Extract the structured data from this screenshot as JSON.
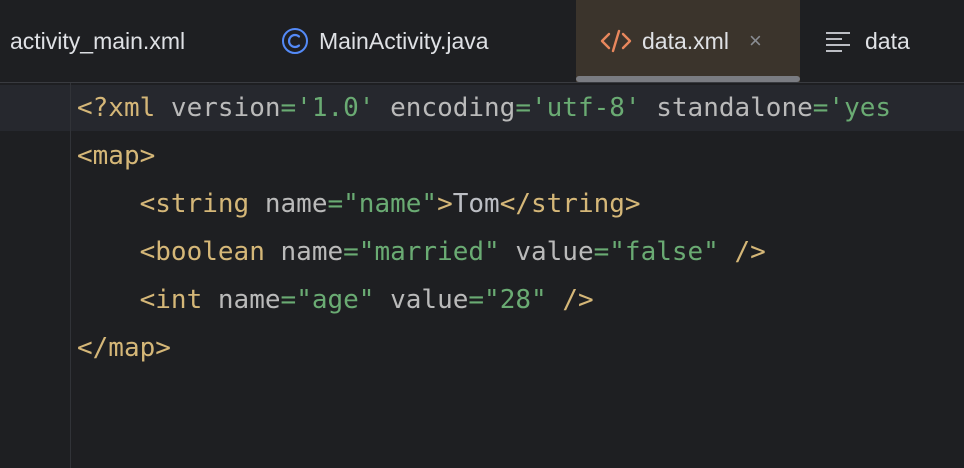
{
  "tabs": [
    {
      "label": "activity_main.xml",
      "active": false
    },
    {
      "label": "MainActivity.java",
      "icon": "java-class-icon",
      "active": false
    },
    {
      "label": "data.xml",
      "icon": "xml-code-icon",
      "active": true,
      "close": "×"
    },
    {
      "label": "data",
      "icon": "text-lines-icon",
      "active": false
    }
  ],
  "colors": {
    "background": "#1e1f22",
    "active_tab": "#3b342c",
    "tag": "#d5b778",
    "attribute": "#bababa",
    "string_value": "#6aab73",
    "text": "#bcbec4",
    "java_icon": "#548af7",
    "xml_icon": "#e8875d"
  },
  "code": {
    "line1": {
      "open": "<?xml",
      "a1": " version",
      "eq1": "=",
      "v1": "'1.0'",
      "a2": " encoding",
      "eq2": "=",
      "v2": "'utf-8'",
      "a3": " standalone",
      "eq3": "=",
      "v3": "'yes"
    },
    "line2": {
      "tag": "<map>"
    },
    "line3": {
      "indent": "    ",
      "open": "<string",
      "a1": " name",
      "eq1": "=",
      "v1": "\"name\"",
      "close": ">",
      "text": "Tom",
      "end": "</string>"
    },
    "line4": {
      "indent": "    ",
      "open": "<boolean",
      "a1": " name",
      "eq1": "=",
      "v1": "\"married\"",
      "a2": " value",
      "eq2": "=",
      "v2": "\"false\"",
      "end": " />"
    },
    "line5": {
      "indent": "    ",
      "open": "<int",
      "a1": " name",
      "eq1": "=",
      "v1": "\"age\"",
      "a2": " value",
      "eq2": "=",
      "v2": "\"28\"",
      "end": " />"
    },
    "line6": {
      "tag": "</map>"
    }
  }
}
